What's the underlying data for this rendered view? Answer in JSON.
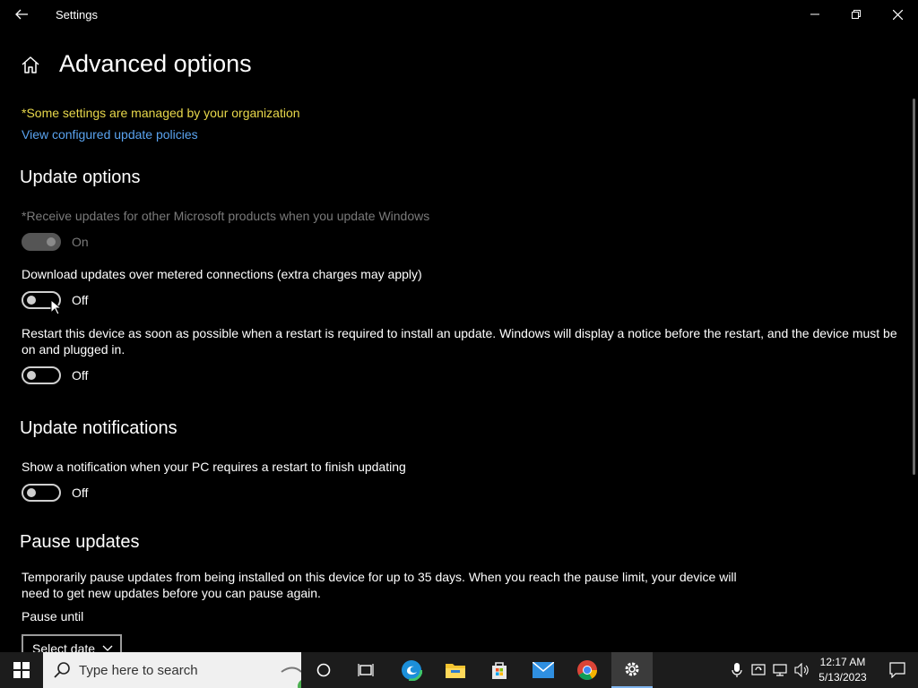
{
  "window": {
    "title": "Settings"
  },
  "header": {
    "title": "Advanced options"
  },
  "managed_note": "*Some settings are managed by your organization",
  "policies_link": "View configured update policies",
  "update_options": {
    "title": "Update options",
    "settings": [
      {
        "label": "*Receive updates for other Microsoft products when you update Windows",
        "state": "On",
        "enabled": false
      },
      {
        "label": "Download updates over metered connections (extra charges may apply)",
        "state": "Off",
        "enabled": true
      },
      {
        "label": "Restart this device as soon as possible when a restart is required to install an update. Windows will display a notice before the restart, and the device must be on and plugged in.",
        "state": "Off",
        "enabled": true
      }
    ]
  },
  "update_notifications": {
    "title": "Update notifications",
    "setting": {
      "label": "Show a notification when your PC requires a restart to finish updating",
      "state": "Off"
    }
  },
  "pause_updates": {
    "title": "Pause updates",
    "description": "Temporarily pause updates from being installed on this device for up to 35 days. When you reach the pause limit, your device will need to get new updates before you can pause again.",
    "pause_until_label": "Pause until",
    "select_value": "Select date"
  },
  "taskbar": {
    "search_placeholder": "Type here to search",
    "time": "12:17 AM",
    "date": "5/13/2023",
    "icons": [
      "windows-start-icon",
      "search-icon",
      "cortana-icon",
      "task-view-icon",
      "edge-icon",
      "file-explorer-icon",
      "microsoft-store-icon",
      "mail-icon",
      "chrome-icon",
      "settings-gear-icon",
      "microphone-icon",
      "network-icon",
      "volume-icon",
      "notification-icon"
    ]
  },
  "colors": {
    "managed_note": "#e8d84b",
    "link": "#5aa3ef",
    "background": "#000000",
    "taskbar": "#1c1c1c"
  }
}
